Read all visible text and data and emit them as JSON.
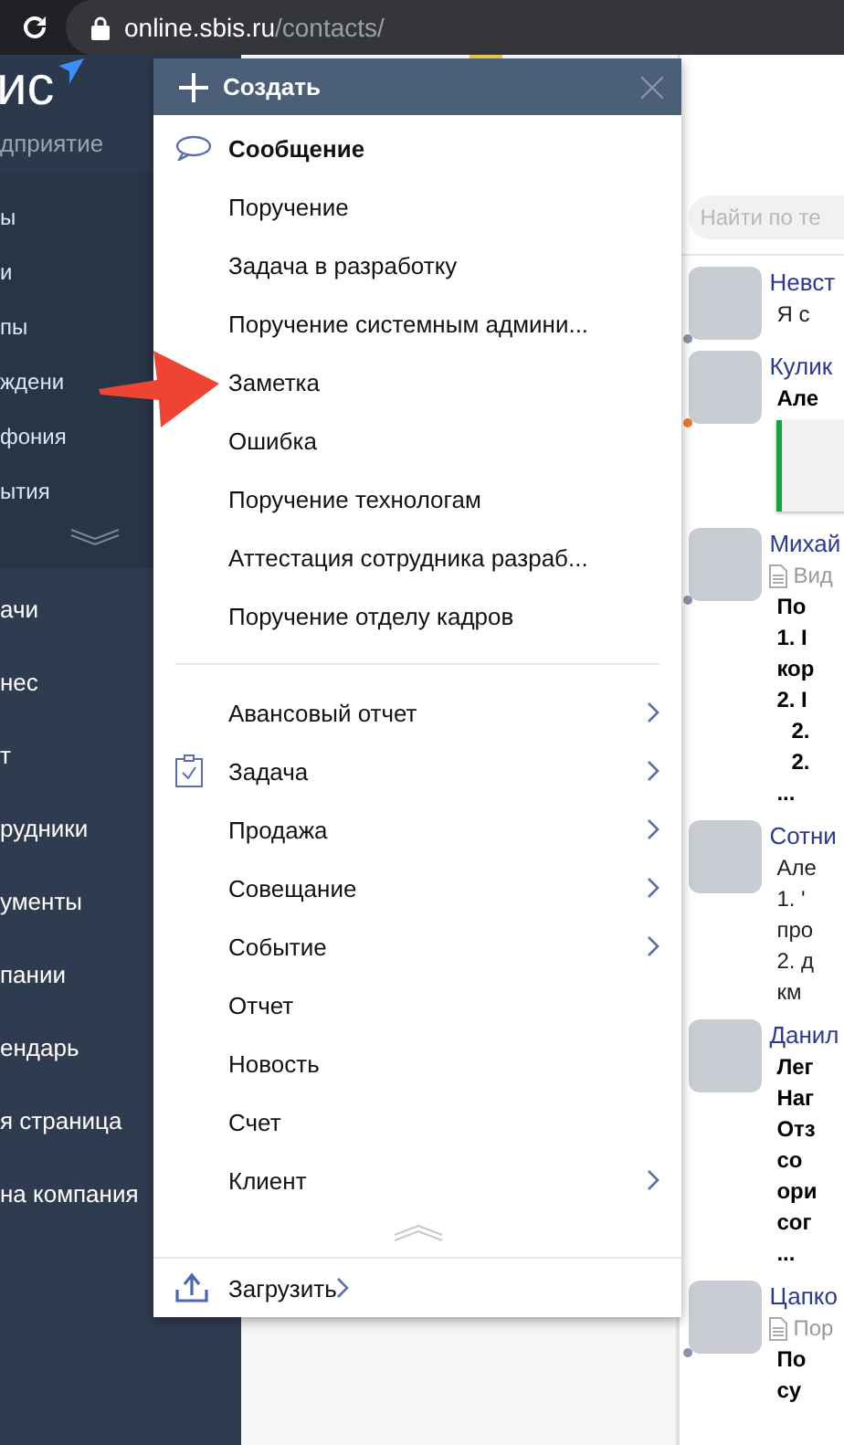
{
  "browser": {
    "url_host": "online.sbis.ru",
    "url_path": "/contacts/"
  },
  "sidebar": {
    "logo": "ис",
    "subtitle": "дприятие",
    "top_items": [
      "ы",
      "и",
      "пы",
      "ждени",
      "фония",
      "ытия"
    ],
    "main_items": [
      "ачи",
      "нес",
      "т",
      "рудники",
      "ументы",
      "пании",
      "ендарь",
      "я страница",
      "на компания"
    ]
  },
  "feed": {
    "search": {
      "placeholder": "Найти по те"
    },
    "entries": [
      {
        "name": "Невст",
        "color": "#8a93a8",
        "lines": [
          {
            "kind": "text",
            "text": "Я с"
          }
        ]
      },
      {
        "name": "Кулик",
        "color": "#f07a2a",
        "lines": [
          {
            "kind": "bold",
            "text": "Але"
          },
          {
            "kind": "thumbnail"
          }
        ]
      },
      {
        "name": "Михай",
        "color": "#8a93a8",
        "lines": [
          {
            "kind": "doc",
            "text": "Вид"
          },
          {
            "kind": "bold",
            "text": "По"
          },
          {
            "kind": "bold",
            "text": "1. I"
          },
          {
            "kind": "bold",
            "text": "кор"
          },
          {
            "kind": "bold",
            "text": "2. I"
          },
          {
            "kind": "bold_sub",
            "text": "2."
          },
          {
            "kind": "bold_sub",
            "text": "2."
          },
          {
            "kind": "bold",
            "text": "..."
          }
        ]
      },
      {
        "name": "Сотни",
        "lines": [
          {
            "kind": "text",
            "text": "Але"
          },
          {
            "kind": "text",
            "text": "1. '"
          },
          {
            "kind": "text",
            "text": "про"
          },
          {
            "kind": "text",
            "text": "2. д"
          },
          {
            "kind": "text",
            "text": "км"
          }
        ]
      },
      {
        "name": "Данил",
        "lines": [
          {
            "kind": "bold",
            "text": "Лег"
          },
          {
            "kind": "bold",
            "text": "Наг"
          },
          {
            "kind": "bold",
            "text": "Отз"
          },
          {
            "kind": "bold",
            "text": "со"
          },
          {
            "kind": "bold",
            "text": "ори"
          },
          {
            "kind": "bold",
            "text": "сог"
          },
          {
            "kind": "bold",
            "text": "..."
          }
        ]
      },
      {
        "name": "Цапко",
        "color": "#8a93a8",
        "lines": [
          {
            "kind": "doc",
            "text": "Пор"
          },
          {
            "kind": "bold",
            "text": "По"
          },
          {
            "kind": "bold",
            "text": "су"
          }
        ]
      }
    ]
  },
  "create_menu": {
    "title": "Создать",
    "groups": [
      [
        {
          "label": "Сообщение",
          "kind": "message",
          "bold": true,
          "submenu": false
        },
        {
          "label": "Поручение",
          "kind": "plain",
          "bold": false,
          "submenu": false
        },
        {
          "label": "Задача в разработку",
          "kind": "plain",
          "bold": false,
          "submenu": false
        },
        {
          "label": "Поручение системным админи...",
          "kind": "plain",
          "bold": false,
          "submenu": false
        },
        {
          "label": "Заметка",
          "kind": "plain",
          "bold": false,
          "submenu": false
        },
        {
          "label": "Ошибка",
          "kind": "plain",
          "bold": false,
          "submenu": false
        },
        {
          "label": "Поручение технологам",
          "kind": "plain",
          "bold": false,
          "submenu": false
        },
        {
          "label": "Аттестация сотрудника разраб...",
          "kind": "plain",
          "bold": false,
          "submenu": false
        },
        {
          "label": "Поручение отделу кадров",
          "kind": "plain",
          "bold": false,
          "submenu": false
        }
      ],
      [
        {
          "label": "Авансовый отчет",
          "kind": "plain",
          "bold": false,
          "submenu": true
        },
        {
          "label": "Задача",
          "kind": "task",
          "bold": false,
          "submenu": true
        },
        {
          "label": "Продажа",
          "kind": "plain",
          "bold": false,
          "submenu": true
        },
        {
          "label": "Совещание",
          "kind": "plain",
          "bold": false,
          "submenu": true
        },
        {
          "label": "Событие",
          "kind": "plain",
          "bold": false,
          "submenu": true
        },
        {
          "label": "Отчет",
          "kind": "plain",
          "bold": false,
          "submenu": false
        },
        {
          "label": "Новость",
          "kind": "plain",
          "bold": false,
          "submenu": false
        },
        {
          "label": "Счет",
          "kind": "plain",
          "bold": false,
          "submenu": false
        },
        {
          "label": "Клиент",
          "kind": "plain",
          "bold": false,
          "submenu": true
        }
      ]
    ],
    "footer": {
      "label": "Загрузить",
      "submenu": true
    }
  }
}
